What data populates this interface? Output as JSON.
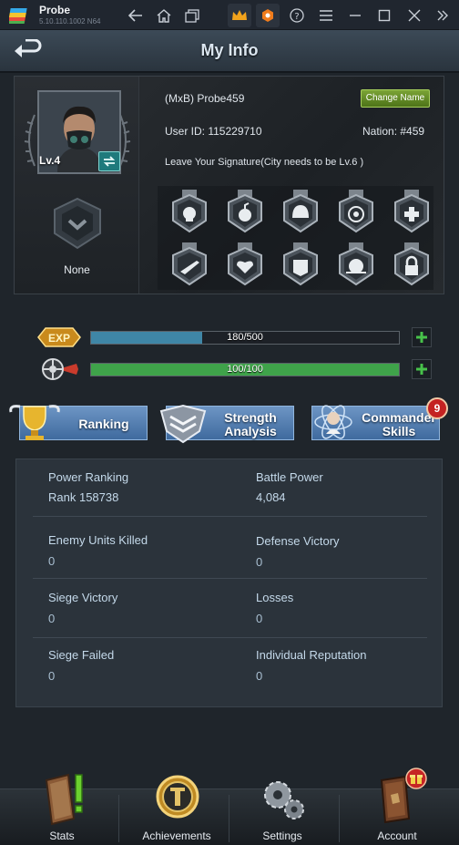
{
  "emulator": {
    "app_name": "Probe",
    "version": "5.10.110.1002 N64"
  },
  "header": {
    "title": "My Info"
  },
  "profile": {
    "level": "Lv.4",
    "emblem_label": "None",
    "name": "(MxB) Probe459",
    "change_name_label": "Change Name",
    "user_id": "User ID: 115229710",
    "nation": "Nation: #459",
    "signature": "Leave Your Signature(City needs to be Lv.6 )",
    "medals": [
      "skull-medal-icon",
      "bomb-medal-icon",
      "helmet-medal-icon",
      "biohazard-medal-icon",
      "medic-medal-icon",
      "rifle-medal-icon",
      "heart-medal-icon",
      "armor-medal-icon",
      "skull-crest-medal-icon",
      "locked-medal-icon"
    ]
  },
  "bars": {
    "exp": {
      "text": "180/500",
      "fraction": 0.36,
      "color": "#3f86a6"
    },
    "stamina": {
      "text": "100/100",
      "fraction": 1.0,
      "color": "#3fa34a"
    }
  },
  "actions": {
    "ranking": "Ranking",
    "strength_line1": "Strength",
    "strength_line2": "Analysis",
    "commander_line1": "Commander",
    "commander_line2": "Skills",
    "commander_badge": "9"
  },
  "stats": {
    "power_ranking_label": "Power Ranking",
    "power_ranking_value": "Rank 158738",
    "battle_power_label": "Battle Power",
    "battle_power_value": "4,084",
    "enemy_killed_label": "Enemy Units Killed",
    "enemy_killed_value": "0",
    "defense_victory_label": "Defense Victory",
    "defense_victory_value": "0",
    "siege_victory_label": "Siege Victory",
    "siege_victory_value": "0",
    "losses_label": "Losses",
    "losses_value": "0",
    "siege_failed_label": "Siege Failed",
    "siege_failed_value": "0",
    "reputation_label": "Individual Reputation",
    "reputation_value": "0"
  },
  "nav": {
    "stats": "Stats",
    "achievements": "Achievements",
    "settings": "Settings",
    "account": "Account"
  }
}
